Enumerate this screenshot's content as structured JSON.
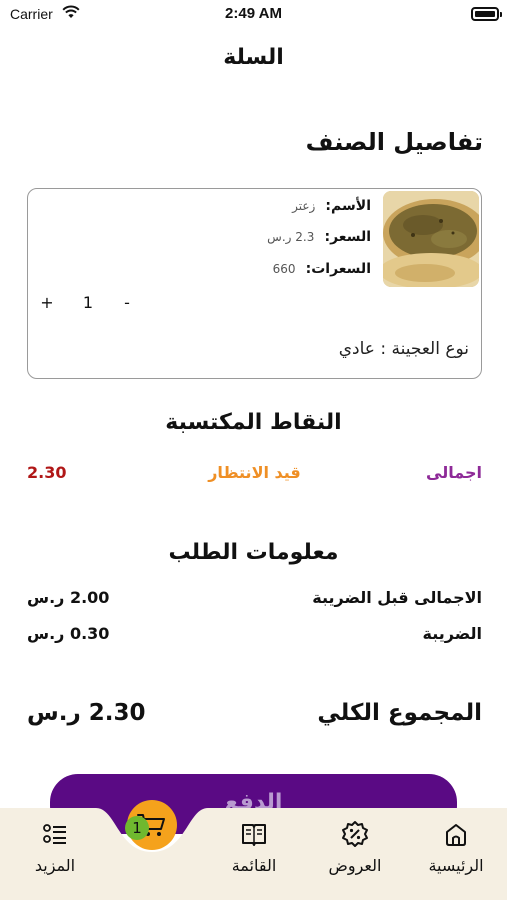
{
  "status_bar": {
    "carrier": "Carrier",
    "time": "2:49 AM"
  },
  "header": {
    "title": "السلة"
  },
  "item_section": {
    "title": "تفاصيل الصنف",
    "image_icon": "zaatar-manakish-photo",
    "name_label": "الأسم:",
    "name_value": "زعتر",
    "price_label": "السعر:",
    "price_value": "2.3 ر.س",
    "calories_label": "السعرات:",
    "calories_value": "660",
    "quantity": "1",
    "plus": "+",
    "minus": "-",
    "dough_type": "نوع العجينة : عادي"
  },
  "points": {
    "title": "النقاط المكتسبة",
    "total_label": "اجمالى",
    "pending_label": "قيد الانتظار",
    "value": "2.30",
    "colors": {
      "total": "#8e2a98",
      "pending": "#ef8f25",
      "value": "#b01717"
    }
  },
  "order_info": {
    "title": "معلومات الطلب",
    "subtotal_label": "الاجمالى قبل الضريبة",
    "subtotal_value": "2.00 ر.س",
    "tax_label": "الضريبة",
    "tax_value": "0.30 ر.س"
  },
  "total": {
    "label": "المجموع الكلي",
    "value": "2.30 ر.س"
  },
  "pay_button": {
    "label": "الدفع",
    "color": "#5a0a84"
  },
  "tabbar": {
    "items": [
      {
        "label": "الرئيسية",
        "icon": "home-icon"
      },
      {
        "label": "العروض",
        "icon": "discount-badge-icon"
      },
      {
        "label": "القائمة",
        "icon": "menu-book-icon"
      },
      {
        "label": "المزيد",
        "icon": "list-more-icon"
      }
    ],
    "cart": {
      "icon": "cart-icon",
      "badge": "1",
      "color": "#f5a21c"
    }
  }
}
